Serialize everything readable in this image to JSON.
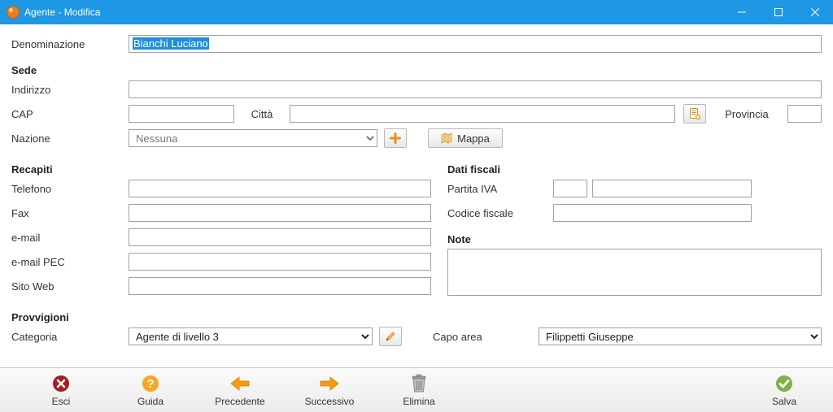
{
  "window": {
    "title": "Agente - Modifica"
  },
  "labels": {
    "denominazione": "Denominazione",
    "sede": "Sede",
    "indirizzo": "Indirizzo",
    "cap": "CAP",
    "citta": "Città",
    "provincia": "Provincia",
    "nazione": "Nazione",
    "mappa": "Mappa",
    "recapiti": "Recapiti",
    "telefono": "Telefono",
    "fax": "Fax",
    "email": "e-mail",
    "emailpec": "e-mail PEC",
    "sitoweb": "Sito Web",
    "datifiscali": "Dati fiscali",
    "piva": "Partita IVA",
    "cf": "Codice fiscale",
    "note": "Note",
    "provvigioni": "Provvigioni",
    "categoria": "Categoria",
    "capoarea": "Capo area"
  },
  "values": {
    "denominazione": "Bianchi Luciano",
    "indirizzo": "",
    "cap": "",
    "citta": "",
    "provincia": "",
    "nazione": "Nessuna",
    "telefono": "",
    "fax": "",
    "email": "",
    "emailpec": "",
    "sitoweb": "",
    "piva_prefix": "",
    "piva": "",
    "cf": "",
    "note": "",
    "categoria": "Agente di livello 3",
    "capoarea": "Filippetti Giuseppe"
  },
  "toolbar": {
    "esci": "Esci",
    "guida": "Guida",
    "precedente": "Precedente",
    "successivo": "Successivo",
    "elimina": "Elimina",
    "salva": "Salva"
  }
}
